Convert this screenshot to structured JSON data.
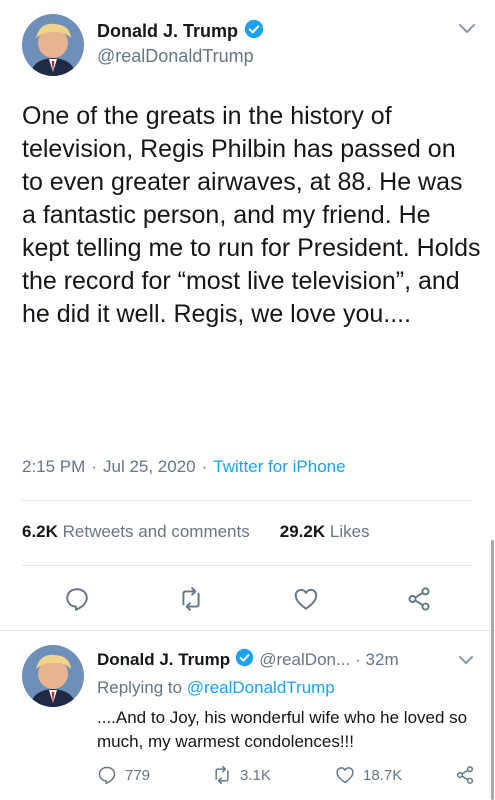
{
  "main_tweet": {
    "author_name": "Donald J. Trump",
    "handle": "@realDonaldTrump",
    "text": "One of the greats in the history of television, Regis Philbin has passed on to even greater airwaves, at 88. He was a fantastic person, and my friend. He kept telling me to run for President. Holds the record for “most live television”, and he did it well. Regis, we love you....",
    "time": "2:15 PM",
    "date": "Jul 25, 2020",
    "separator": "·",
    "source": "Twitter for iPhone",
    "retweets_count": "6.2K",
    "retweets_label": "Retweets and comments",
    "likes_count": "29.2K",
    "likes_label": "Likes",
    "icons": [
      "reply-icon",
      "retweet-icon",
      "like-icon",
      "share-icon"
    ]
  },
  "reply_tweet": {
    "author_name": "Donald J. Trump",
    "handle": "@realDon...",
    "time_ago": "· 32m",
    "replying_to_label": "Replying to",
    "replying_to_handle": "@realDonaldTrump",
    "text": "....And to Joy, his wonderful wife who he loved so much, my warmest condolences!!!",
    "reply_count": "779",
    "retweet_count": "3.1K",
    "like_count": "18.7K"
  },
  "colors": {
    "accent": "#1da1f2",
    "muted": "#657786",
    "text": "#14171a",
    "divider": "#e1e8ed"
  }
}
